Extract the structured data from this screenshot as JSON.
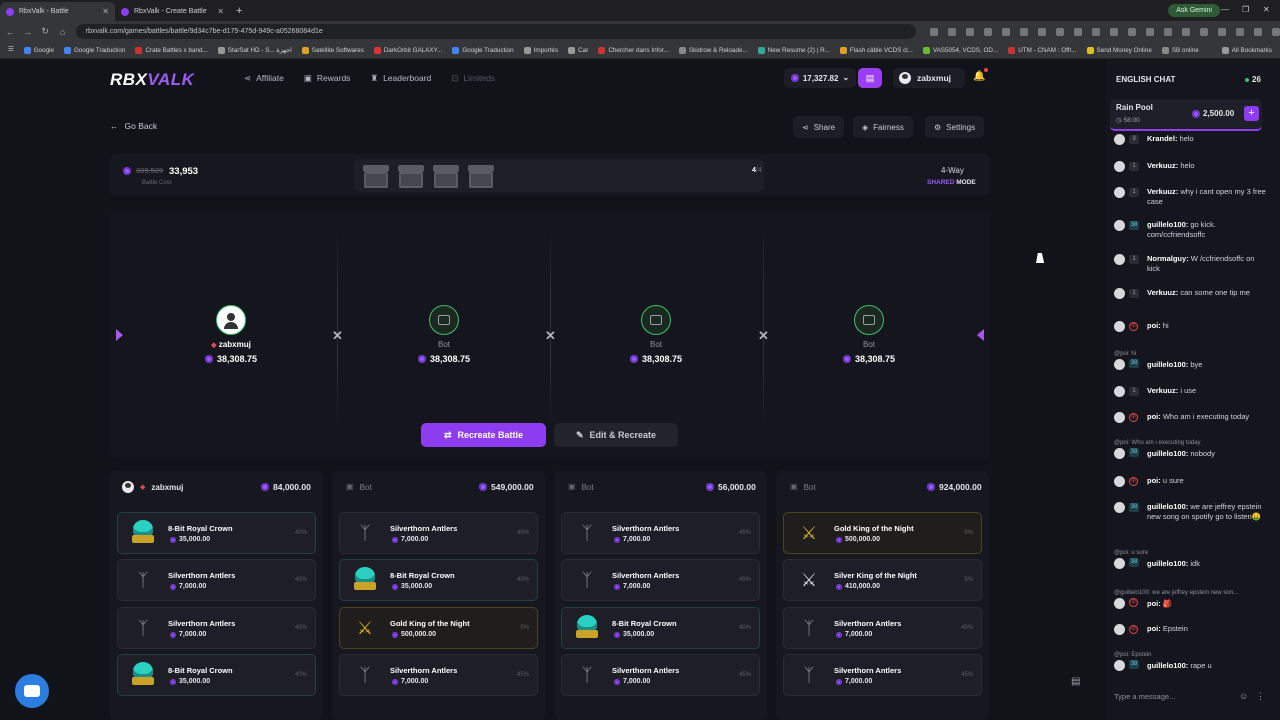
{
  "browser": {
    "tabs": [
      {
        "label": "RbxValk - Battle",
        "active": true
      },
      {
        "label": "RbxValk - Create Battle",
        "active": false
      }
    ],
    "url": "rbxvalk.com/games/battles/battle/9d34c7be-d175-475d-949c-a05268084d1e",
    "gemini_label": "Ask Gemini",
    "bookmarks": [
      "Google",
      "Google Traduction",
      "Crate Battles x band...",
      "StarSat HD - S... اجهزة",
      "Satellite Softwares",
      "DarkOrbit GALAXY...",
      "Google Traduction",
      "Importés",
      "Car",
      "Chercher dans Infor...",
      "Skidrow & Reloade...",
      "New Resume (2) | R...",
      "Flash câble VCDS cl...",
      "VAS5054, VCDS, OD...",
      "UTM - CNAM : Offr...",
      "Send Money Online",
      "SB online"
    ],
    "all_bookmarks": "All Bookmarks"
  },
  "header": {
    "logo_a": "RBX",
    "logo_b": "VALK",
    "nav": [
      {
        "label": "Affiliate",
        "icon": "share-icon",
        "enabled": true
      },
      {
        "label": "Rewards",
        "icon": "gift-icon",
        "enabled": true
      },
      {
        "label": "Leaderboard",
        "icon": "trophy-icon",
        "enabled": true
      },
      {
        "label": "Limiteds",
        "icon": "cart-icon",
        "enabled": false
      }
    ],
    "balance": "17,327.82",
    "username": "zabxmuj"
  },
  "subheader": {
    "back": "Go Back",
    "share": "Share",
    "fairness": "Fairness",
    "settings": "Settings"
  },
  "battle": {
    "cost_old": "339,529",
    "cost_new": "33,953",
    "cost_label": "Battle Cost",
    "case_count": "4",
    "case_total": "/4",
    "mode_top": "4-Way",
    "mode_shared": "SHARED",
    "mode_word": "MODE",
    "players": [
      {
        "name": "zabxmuj",
        "type": "user",
        "amount": "38,308.75"
      },
      {
        "name": "Bot",
        "type": "bot",
        "amount": "38,308.75"
      },
      {
        "name": "Bot",
        "type": "bot",
        "amount": "38,308.75"
      },
      {
        "name": "Bot",
        "type": "bot",
        "amount": "38,308.75"
      }
    ],
    "recreate": "Recreate Battle",
    "edit_recreate": "Edit & Recreate"
  },
  "columns": [
    {
      "name": "zabxmuj",
      "type": "user",
      "total": "84,000.00",
      "items": [
        {
          "name": "8-Bit Royal Crown",
          "value": "35,000.00",
          "pct": "40%",
          "kind": "crown"
        },
        {
          "name": "Silverthorn Antlers",
          "value": "7,000.00",
          "pct": "45%",
          "kind": "antler"
        },
        {
          "name": "Silverthorn Antlers",
          "value": "7,000.00",
          "pct": "45%",
          "kind": "antler"
        },
        {
          "name": "8-Bit Royal Crown",
          "value": "35,000.00",
          "pct": "40%",
          "kind": "crown"
        }
      ]
    },
    {
      "name": "Bot",
      "type": "bot",
      "total": "549,000.00",
      "items": [
        {
          "name": "Silverthorn Antlers",
          "value": "7,000.00",
          "pct": "45%",
          "kind": "antler"
        },
        {
          "name": "8-Bit Royal Crown",
          "value": "35,000.00",
          "pct": "40%",
          "kind": "crown"
        },
        {
          "name": "Gold King of the Night",
          "value": "500,000.00",
          "pct": "5%",
          "kind": "goldk"
        },
        {
          "name": "Silverthorn Antlers",
          "value": "7,000.00",
          "pct": "45%",
          "kind": "antler"
        }
      ]
    },
    {
      "name": "Bot",
      "type": "bot",
      "total": "56,000.00",
      "items": [
        {
          "name": "Silverthorn Antlers",
          "value": "7,000.00",
          "pct": "45%",
          "kind": "antler"
        },
        {
          "name": "Silverthorn Antlers",
          "value": "7,000.00",
          "pct": "45%",
          "kind": "antler"
        },
        {
          "name": "8-Bit Royal Crown",
          "value": "35,000.00",
          "pct": "40%",
          "kind": "crown"
        },
        {
          "name": "Silverthorn Antlers",
          "value": "7,000.00",
          "pct": "45%",
          "kind": "antler"
        }
      ]
    },
    {
      "name": "Bot",
      "type": "bot",
      "total": "924,000.00",
      "items": [
        {
          "name": "Gold King of the Night",
          "value": "500,000.00",
          "pct": "5%",
          "kind": "goldk"
        },
        {
          "name": "Silver King of the Night",
          "value": "410,000.00",
          "pct": "5%",
          "kind": "silverk"
        },
        {
          "name": "Silverthorn Antlers",
          "value": "7,000.00",
          "pct": "45%",
          "kind": "antler"
        },
        {
          "name": "Silverthorn Antlers",
          "value": "7,000.00",
          "pct": "45%",
          "kind": "antler"
        }
      ]
    }
  ],
  "chat": {
    "title": "ENGLISH CHAT",
    "online": "26",
    "rain_title": "Rain Pool",
    "rain_time": "58:00",
    "rain_amount": "2,500.00",
    "placeholder": "Type a message...",
    "messages": [
      {
        "lvl": "3",
        "user": "Krandel",
        "text": "helo",
        "reply": ""
      },
      {
        "lvl": "1",
        "user": "Verkuuz",
        "text": "helo",
        "reply": ""
      },
      {
        "lvl": "1",
        "user": "Verkuuz",
        "text": "why i cant open my 3 free case",
        "reply": ""
      },
      {
        "lvl": "38",
        "user": "guillelo100",
        "text": "go kick. com/ccfriendsoffc",
        "reply": ""
      },
      {
        "lvl": "1",
        "user": "Normalguy",
        "text": "W /ccfriendsoffc on kick",
        "reply": ""
      },
      {
        "lvl": "1",
        "user": "Verkuuz",
        "text": "can some one tip me",
        "reply": ""
      },
      {
        "lvl": "",
        "user": "poi",
        "text": "hi",
        "reply": ""
      },
      {
        "lvl": "38",
        "user": "guillelo100",
        "text": "bye",
        "reply": "@poi: hi"
      },
      {
        "lvl": "1",
        "user": "Verkuuz",
        "text": "i use",
        "reply": ""
      },
      {
        "lvl": "",
        "user": "poi",
        "text": "Who am i executing today",
        "reply": ""
      },
      {
        "lvl": "38",
        "user": "guillelo100",
        "text": "nobody",
        "reply": "@poi: Who am i executing today"
      },
      {
        "lvl": "",
        "user": "poi",
        "text": "u sure",
        "reply": ""
      },
      {
        "lvl": "38",
        "user": "guillelo100",
        "text": "we are jeffrey epstein new song on spotify go to listen🤑",
        "reply": ""
      },
      {
        "lvl": "38",
        "user": "guillelo100",
        "text": "idk",
        "reply": "@poi: u sure"
      },
      {
        "lvl": "",
        "user": "poi",
        "text": "🎒",
        "reply": "@guillelo100: we are jeffrey epstein new son..."
      },
      {
        "lvl": "",
        "user": "poi",
        "text": "Epstein",
        "reply": ""
      },
      {
        "lvl": "38",
        "user": "guillelo100",
        "text": "rape u",
        "reply": "@poi: Epstein"
      }
    ]
  },
  "colors": {
    "accent": "#8e3cf0",
    "online": "#3fbf6d",
    "bg": "#121319"
  }
}
